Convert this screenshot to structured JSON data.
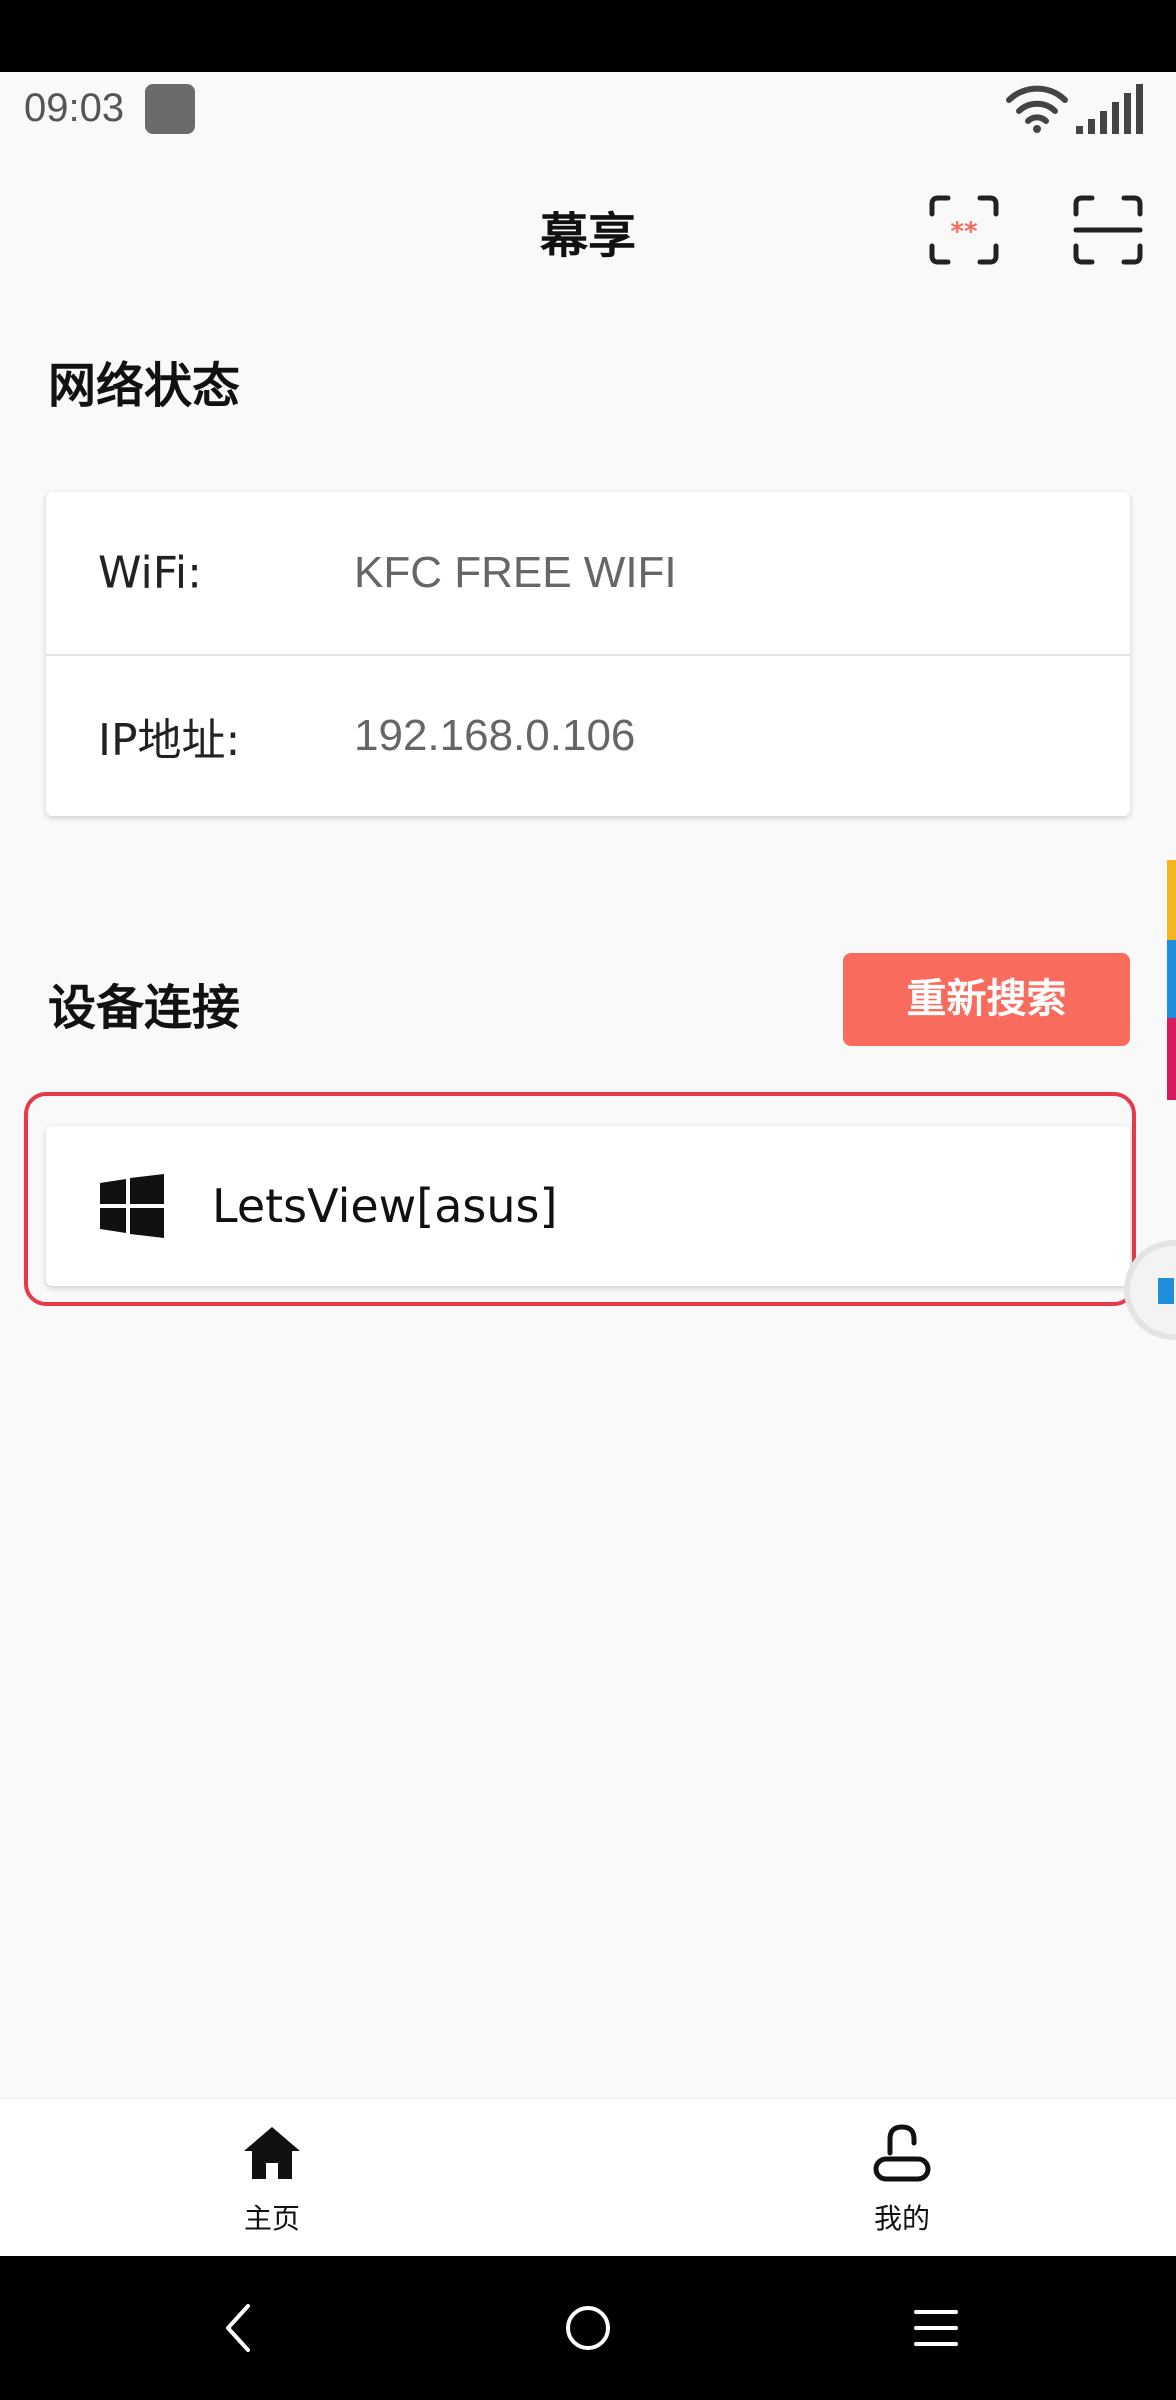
{
  "status_bar": {
    "time": "09:03",
    "icons": [
      "app-notification-icon",
      "wifi-icon",
      "signal-icon"
    ]
  },
  "header": {
    "title": "幕享",
    "actions": [
      "scan-password-icon",
      "scan-icon"
    ]
  },
  "network": {
    "section_title": "网络状态",
    "rows": [
      {
        "label": "WiFi:",
        "value": "KFC FREE WIFI"
      },
      {
        "label": "IP地址:",
        "value": "192.168.0.106"
      }
    ]
  },
  "devices": {
    "section_title": "设备连接",
    "research_label": "重新搜索",
    "items": [
      {
        "icon": "windows-icon",
        "name": "LetsView[asus]"
      }
    ]
  },
  "bottom_nav": {
    "items": [
      {
        "icon": "home-icon",
        "label": "主页"
      },
      {
        "icon": "user-icon",
        "label": "我的"
      }
    ]
  },
  "colors": {
    "accent": "#f96c5d",
    "highlight_border": "#e8394a",
    "page_bg": "#f9f9f9",
    "side_strip": [
      "#f5b51e",
      "#1e8fdc",
      "#d81b60"
    ]
  }
}
